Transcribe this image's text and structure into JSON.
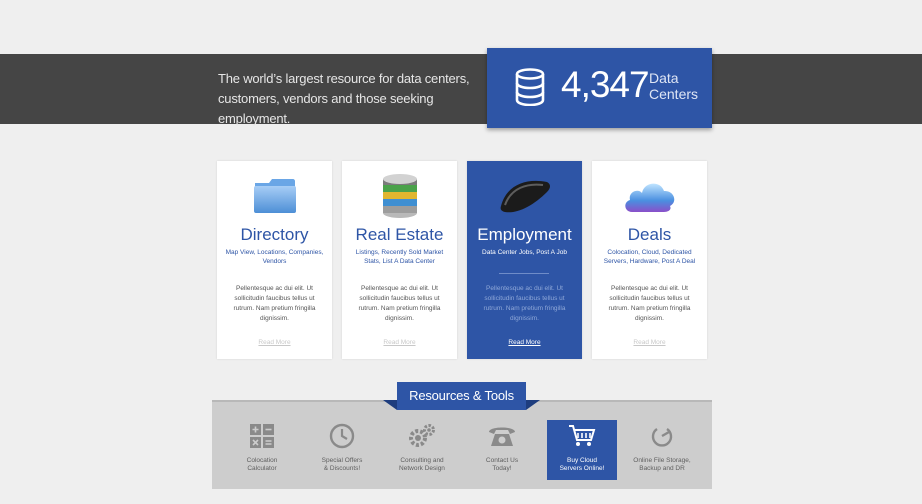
{
  "hero": {
    "tagline_line1": "The world’s largest resource for data centers,",
    "tagline_line2": "customers, vendors and those seeking employment.",
    "stat_number": "4,347",
    "stat_label_line1": "Data",
    "stat_label_line2": "Centers",
    "stat_icon": "database-icon",
    "accent": "#2e55a6"
  },
  "cards": [
    {
      "title": "Directory",
      "subtitle": "Map View, Locations, Companies, Vendors",
      "body": "Pellentesque ac dui elit. Ut sollicitudin faucibus tellus ut rutrum. Nam pretium fringilla dignissim.",
      "link": "Read More",
      "icon": "folder-icon"
    },
    {
      "title": "Real Estate",
      "subtitle": "Listings, Recently Sold Market Stats, List A Data Center",
      "body": "Pellentesque ac dui elit. Ut sollicitudin faucibus tellus ut rutrum. Nam pretium fringilla dignissim.",
      "link": "Read More",
      "icon": "server-stack-icon"
    },
    {
      "title": "Employment",
      "subtitle": "Data Center Jobs, Post A Job",
      "body": "Pellentesque ac dui elit. Ut sollicitudin faucibus tellus ut rutrum. Nam pretium fringilla dignissim.",
      "link": "Read More",
      "icon": "mouse-icon"
    },
    {
      "title": "Deals",
      "subtitle": "Colocation, Cloud, Dedicated Servers, Hardware, Post A Deal",
      "body": "Pellentesque ac dui elit. Ut sollicitudin faucibus tellus ut rutrum. Nam pretium fringilla dignissim.",
      "link": "Read More",
      "icon": "cloud-icon"
    }
  ],
  "resources": {
    "title": "Resources & Tools",
    "items": [
      {
        "line1": "Colocation",
        "line2": "Calculator",
        "icon": "calculator-icon"
      },
      {
        "line1": "Special Offers",
        "line2": "& Discounts!",
        "icon": "clock-icon"
      },
      {
        "line1": "Consulting and",
        "line2": "Network Design",
        "icon": "gears-icon"
      },
      {
        "line1": "Contact Us",
        "line2": "Today!",
        "icon": "phone-icon"
      },
      {
        "line1": "Buy Cloud",
        "line2": "Servers Online!",
        "icon": "cart-icon"
      },
      {
        "line1": "Online File Storage,",
        "line2": "Backup and DR",
        "icon": "power-icon"
      }
    ]
  }
}
